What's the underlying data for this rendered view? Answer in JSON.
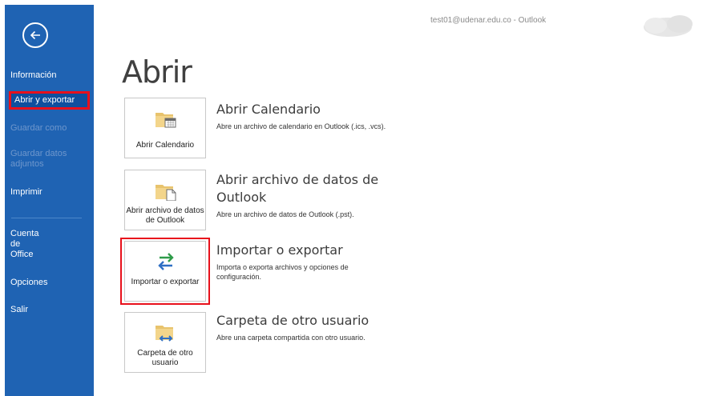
{
  "window": {
    "account_title": "test01@udenar.edu.co  -  Outlook"
  },
  "sidebar": {
    "items": [
      {
        "label": "Información",
        "state": "normal"
      },
      {
        "label": "Abrir y exportar",
        "state": "selected"
      },
      {
        "label": "Guardar como",
        "state": "disabled"
      },
      {
        "label": "Guardar datos adjuntos",
        "state": "disabled"
      },
      {
        "label": "Imprimir",
        "state": "normal"
      },
      {
        "label": "Cuenta de Office",
        "state": "normal"
      },
      {
        "label": "Opciones",
        "state": "normal"
      },
      {
        "label": "Salir",
        "state": "normal"
      }
    ]
  },
  "main": {
    "title": "Abrir",
    "options": [
      {
        "tile_label": "Abrir Calendario",
        "title": "Abrir Calendario",
        "description": "Abre un archivo de calendario en Outlook (.ics, .vcs).",
        "icon": "calendar-folder-icon"
      },
      {
        "tile_label": "Abrir archivo de datos de Outlook",
        "title": "Abrir archivo de datos de Outlook",
        "description": "Abre un archivo de datos de Outlook (.pst).",
        "icon": "data-file-folder-icon"
      },
      {
        "tile_label": "Importar o exportar",
        "title": "Importar o exportar",
        "description": "Importa o exporta archivos y opciones de configuración.",
        "icon": "import-export-arrows-icon",
        "highlighted": true
      },
      {
        "tile_label": "Carpeta de otro usuario",
        "title": "Carpeta de otro usuario",
        "description": "Abre una carpeta compartida con otro usuario.",
        "icon": "shared-folder-icon"
      }
    ]
  },
  "colors": {
    "sidebar_bg": "#1f63b3",
    "highlight": "#e8101b"
  }
}
